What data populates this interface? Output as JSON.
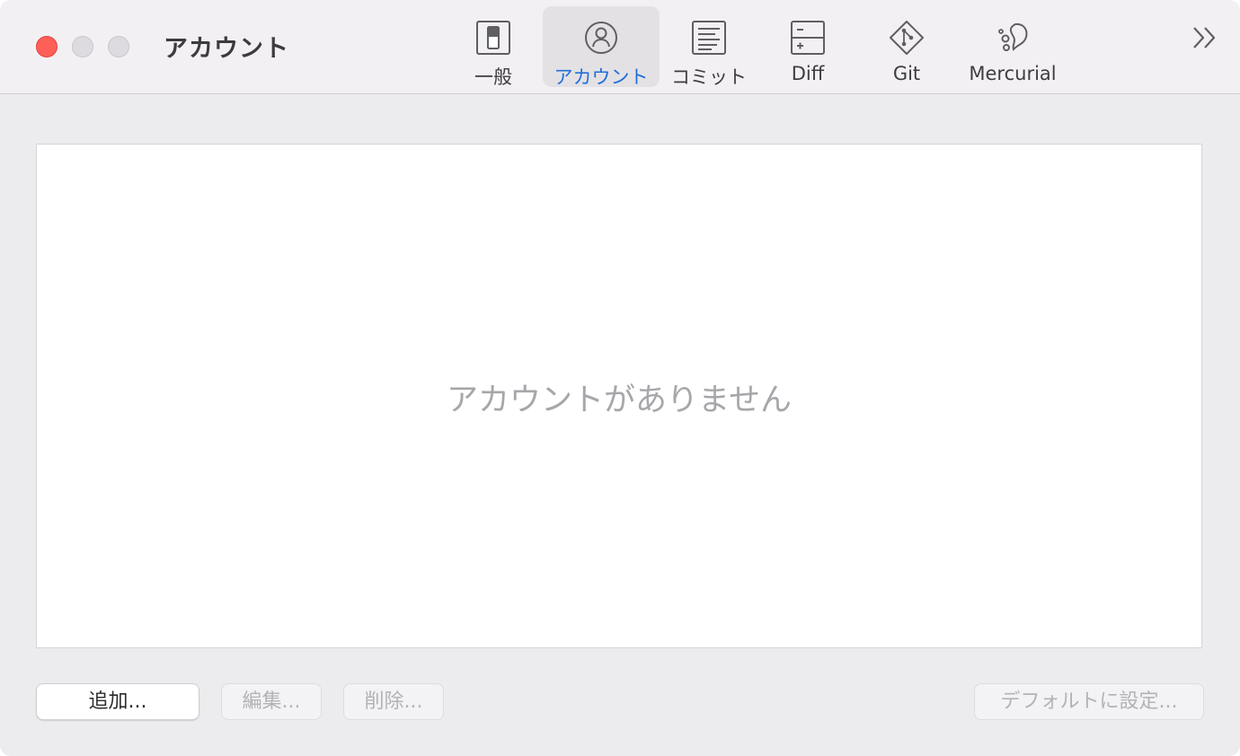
{
  "window": {
    "title": "アカウント"
  },
  "toolbar": {
    "tabs": [
      {
        "label": "一般",
        "icon": "general-toggle-icon",
        "active": false
      },
      {
        "label": "アカウント",
        "icon": "person-circle-icon",
        "active": true
      },
      {
        "label": "コミット",
        "icon": "commit-text-icon",
        "active": false
      },
      {
        "label": "Diff",
        "icon": "diff-icon",
        "active": false
      },
      {
        "label": "Git",
        "icon": "git-icon",
        "active": false
      },
      {
        "label": "Mercurial",
        "icon": "mercurial-icon",
        "active": false
      }
    ],
    "overflow_icon": "double-chevron-right-icon"
  },
  "accounts": {
    "empty_message": "アカウントがありません",
    "items": []
  },
  "buttons": {
    "add": "追加...",
    "edit": "編集...",
    "delete": "削除...",
    "set_default": "デフォルトに設定..."
  },
  "colors": {
    "accent": "#1f6fd8",
    "close": "#fe5f57",
    "window_bg": "#ecebee",
    "titlebar_bg": "#f3f0f4"
  }
}
